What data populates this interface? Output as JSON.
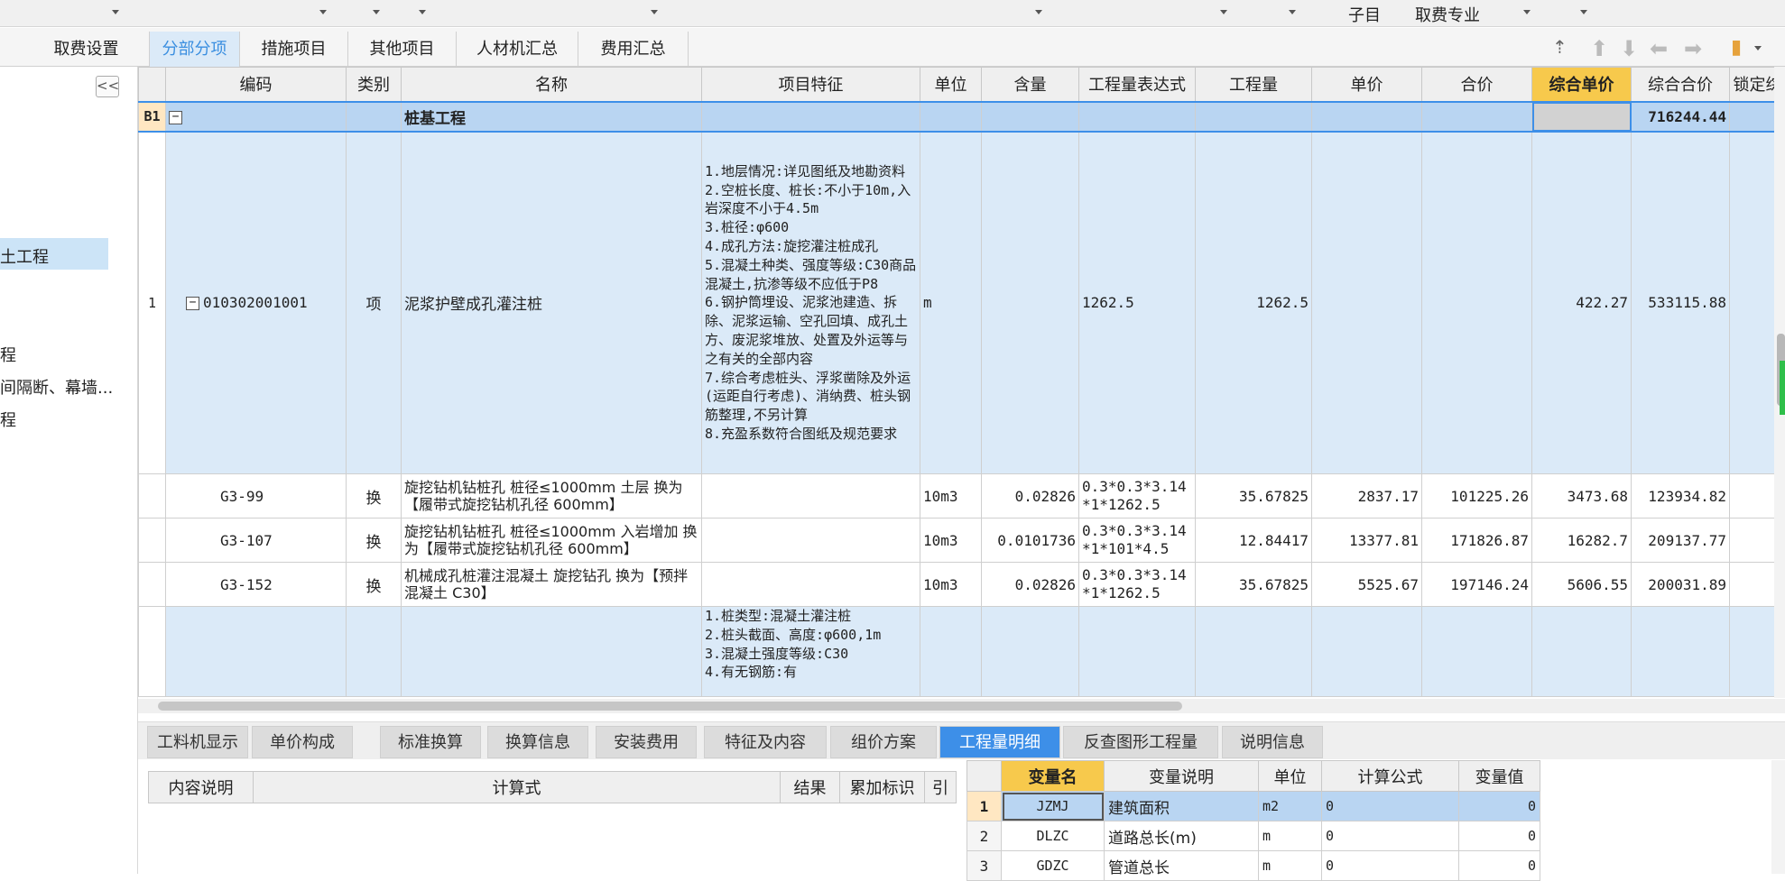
{
  "topbar": {
    "item1": "子目",
    "item2": "取费专业"
  },
  "tabs": [
    "取费设置",
    "分部分项",
    "措施项目",
    "其他项目",
    "人材机汇总",
    "费用汇总"
  ],
  "toolbar_icons": [
    "move-top-icon",
    "move-up-icon",
    "move-down-icon",
    "move-left-icon",
    "move-right-icon",
    "highlight-icon"
  ],
  "tree": {
    "collapse": "<<",
    "items": [
      "土工程",
      "程",
      "间隔断、幕墙...",
      "程"
    ]
  },
  "grid": {
    "headers": [
      "编码",
      "类别",
      "名称",
      "项目特征",
      "单位",
      "含量",
      "工程量表达式",
      "工程量",
      "单价",
      "合价",
      "综合单价",
      "综合合价",
      "锁定综"
    ],
    "b1": {
      "num": "B1",
      "name": "桩基工程",
      "total": "716244.44"
    },
    "rows": [
      {
        "num": "1",
        "code": "010302001001",
        "type": "项",
        "name": "泥浆护壁成孔灌注桩",
        "feature": "1.地层情况:详见图纸及地勘资料\n2.空桩长度、桩长:不小于10m,入岩深度不小于4.5m\n3.桩径:φ600\n4.成孔方法:旋挖灌注桩成孔\n5.混凝土种类、强度等级:C30商品混凝土,抗渗等级不应低于P8\n6.钢护筒埋设、泥浆池建造、拆除、泥浆运输、空孔回填、成孔土方、废泥浆堆放、处置及外运等与之有关的全部内容\n7.综合考虑桩头、浮浆凿除及外运(运距自行考虑)、消纳费、桩头钢筋整理,不另计算\n8.充盈系数符合图纸及规范要求",
        "unit": "m",
        "content": "",
        "expr": "1262.5",
        "qty": "1262.5",
        "price": "",
        "total": "",
        "uprice": "422.27",
        "utotal": "533115.88"
      },
      {
        "num": "",
        "code": "G3-99",
        "type": "换",
        "name": "旋挖钻机钻桩孔 桩径≤1000mm 土层  换为【履带式旋挖钻机孔径 600mm】",
        "feature": "",
        "unit": "10m3",
        "content": "0.02826",
        "expr": "0.3*0.3*3.14*1*1262.5",
        "qty": "35.67825",
        "price": "2837.17",
        "total": "101225.26",
        "uprice": "3473.68",
        "utotal": "123934.82"
      },
      {
        "num": "",
        "code": "G3-107",
        "type": "换",
        "name": "旋挖钻机钻桩孔 桩径≤1000mm 入岩增加  换为【履带式旋挖钻机孔径 600mm】",
        "feature": "",
        "unit": "10m3",
        "content": "0.0101736",
        "expr": "0.3*0.3*3.14*1*101*4.5",
        "qty": "12.84417",
        "price": "13377.81",
        "total": "171826.87",
        "uprice": "16282.7",
        "utotal": "209137.77"
      },
      {
        "num": "",
        "code": "G3-152",
        "type": "换",
        "name": "机械成孔桩灌注混凝土 旋挖钻孔  换为【预拌混凝土 C30】",
        "feature": "",
        "unit": "10m3",
        "content": "0.02826",
        "expr": "0.3*0.3*3.14*1*1262.5",
        "qty": "35.67825",
        "price": "5525.67",
        "total": "197146.24",
        "uprice": "5606.55",
        "utotal": "200031.89"
      },
      {
        "num": "",
        "code": "",
        "type": "",
        "name": "",
        "feature": "1.桩类型:混凝土灌注桩\n2.桩头截面、高度:φ600,1m\n3.混凝土强度等级:C30\n4.有无钢筋:有",
        "unit": "",
        "content": "",
        "expr": "",
        "qty": "",
        "price": "",
        "total": "",
        "uprice": "",
        "utotal": ""
      }
    ]
  },
  "bottom_tabs": [
    "工料机显示",
    "单价构成",
    "标准换算",
    "换算信息",
    "安装费用",
    "特征及内容",
    "组价方案",
    "工程量明细",
    "反查图形工程量",
    "说明信息"
  ],
  "detail_headers": [
    "内容说明",
    "计算式",
    "结果",
    "累加标识",
    "引"
  ],
  "vars": {
    "headers": [
      "变量名",
      "变量说明",
      "单位",
      "计算公式",
      "变量值"
    ],
    "rows": [
      {
        "idx": "1",
        "name": "JZMJ",
        "desc": "建筑面积",
        "unit": "m2",
        "formula": "0",
        "value": "0"
      },
      {
        "idx": "2",
        "name": "DLZC",
        "desc": "道路总长(m)",
        "unit": "m",
        "formula": "0",
        "value": "0"
      },
      {
        "idx": "3",
        "name": "GDZC",
        "desc": "管道总长",
        "unit": "m",
        "formula": "0",
        "value": "0"
      }
    ]
  },
  "colors": {
    "accent": "#3d8fe8",
    "gold": "#f7c94c",
    "row_blue": "#dbeaf8",
    "selected": "#b9d5f2"
  }
}
